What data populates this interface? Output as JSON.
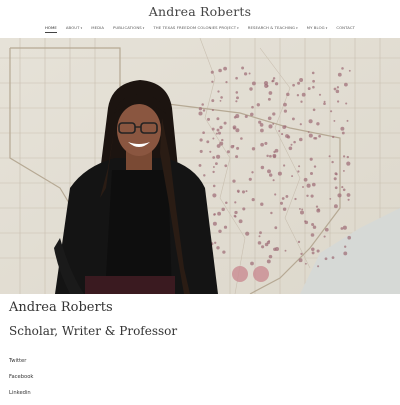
{
  "site": {
    "title": "Andrea Roberts"
  },
  "nav": {
    "items": [
      {
        "label": "HOME",
        "has_dropdown": false,
        "active": true
      },
      {
        "label": "ABOUT",
        "has_dropdown": true
      },
      {
        "label": "MEDIA",
        "has_dropdown": false
      },
      {
        "label": "PUBLICATIONS",
        "has_dropdown": true
      },
      {
        "label": "THE TEXAS FREEDOM COLONIES PROJECT",
        "has_dropdown": true
      },
      {
        "label": "RESEARCH & TEACHING",
        "has_dropdown": true
      },
      {
        "label": "MY BLOG",
        "has_dropdown": true
      },
      {
        "label": "CONTACT",
        "has_dropdown": false
      }
    ],
    "caret": "▾"
  },
  "hero": {
    "image": "portrait-over-map",
    "accent_dot_color": "#a0707a"
  },
  "main": {
    "heading": "Andrea Roberts",
    "tagline": "Scholar, Writer & Professor"
  },
  "social": {
    "links": [
      "Twitter",
      "Facebook",
      "Linkedin"
    ]
  }
}
